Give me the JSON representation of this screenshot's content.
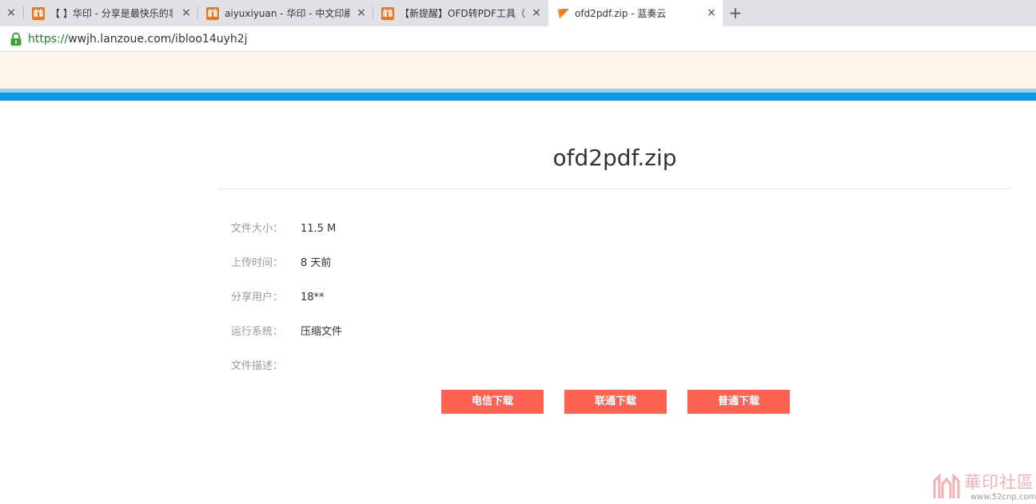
{
  "tabs": [
    {
      "title": "",
      "favicon": "none"
    },
    {
      "title": "【            】华印 - 分享是最快乐的事",
      "favicon": "huayin-logo-icon"
    },
    {
      "title": "aiyuxiyuan - 华印 - 中文印刷社区",
      "favicon": "huayin-logo-icon"
    },
    {
      "title": "【新提醒】OFD转PDF工具（c",
      "favicon": "huayin-logo-icon"
    },
    {
      "title": "ofd2pdf.zip - 蓝奏云",
      "favicon": "lanzou-logo-icon",
      "active": true
    }
  ],
  "new_tab_label": "+",
  "close_label": "×",
  "address": {
    "scheme": "https://",
    "rest": "wwjh.lanzoue.com/ibloo14uyh2j"
  },
  "file": {
    "name": "ofd2pdf.zip",
    "rows": [
      {
        "label": "文件大小：",
        "value": "11.5 M"
      },
      {
        "label": "上传时间：",
        "value": "8 天前"
      },
      {
        "label": "分享用户：",
        "value": "18**"
      },
      {
        "label": "运行系统：",
        "value": "压缩文件"
      },
      {
        "label": "文件描述：",
        "value": ""
      }
    ]
  },
  "buttons": [
    {
      "label": "电信下载"
    },
    {
      "label": "联通下载"
    },
    {
      "label": "普通下载"
    }
  ],
  "watermark": {
    "text": "華印社區",
    "url": "www.52cnp.com"
  },
  "colors": {
    "accent_blue": "#0b98e9",
    "button_red": "#ff6252",
    "banner": "#fff5ea"
  }
}
